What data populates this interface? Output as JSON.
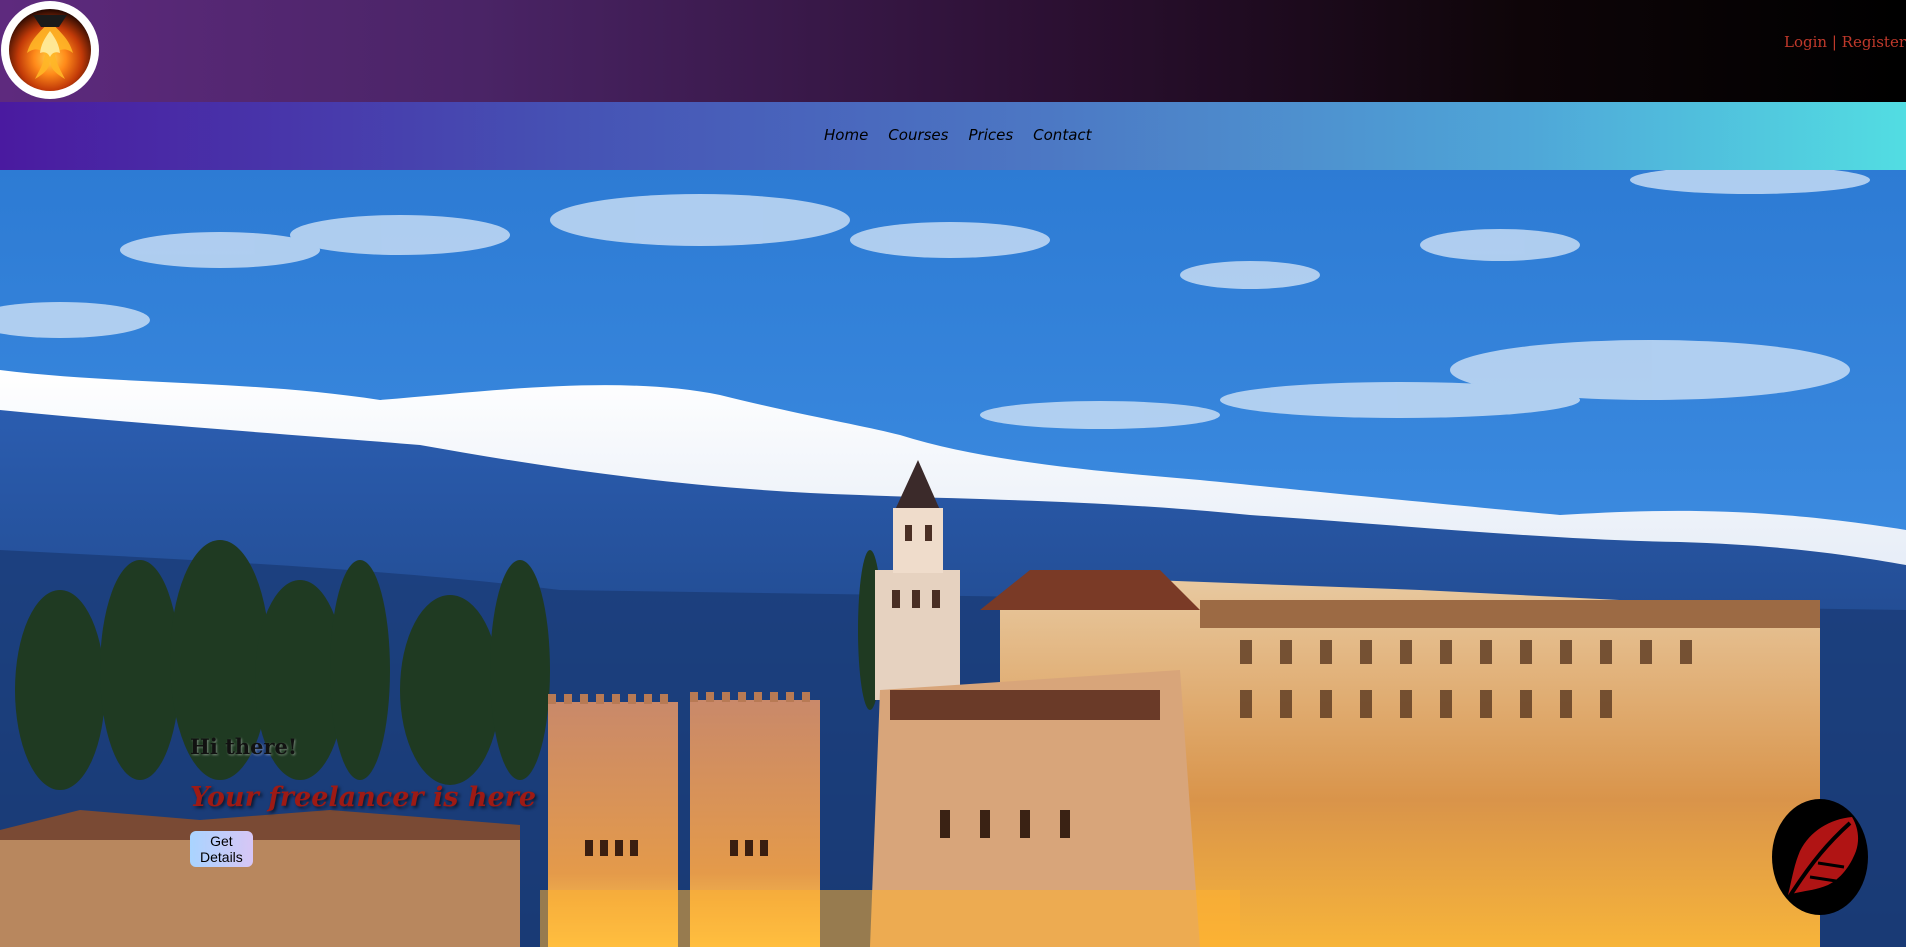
{
  "header": {
    "logo": "phoenix-flame-logo",
    "auth": {
      "login_label": "Login",
      "separator": " | ",
      "register_label": "Register"
    }
  },
  "nav": {
    "items": [
      {
        "label": "Home"
      },
      {
        "label": "Courses"
      },
      {
        "label": "Prices"
      },
      {
        "label": "Contact"
      }
    ]
  },
  "hero": {
    "background": "landscape-mountains-palace",
    "greeting": "Hi there!",
    "tagline": "Your freelancer is here",
    "cta_label": "Get Details"
  },
  "floating_button": {
    "icon": "feather-icon"
  },
  "colors": {
    "accent_red": "#c0392b",
    "tagline_red": "#9e1a14",
    "header_purple": "#5e2a7e",
    "nav_cyan": "#52dde2"
  }
}
